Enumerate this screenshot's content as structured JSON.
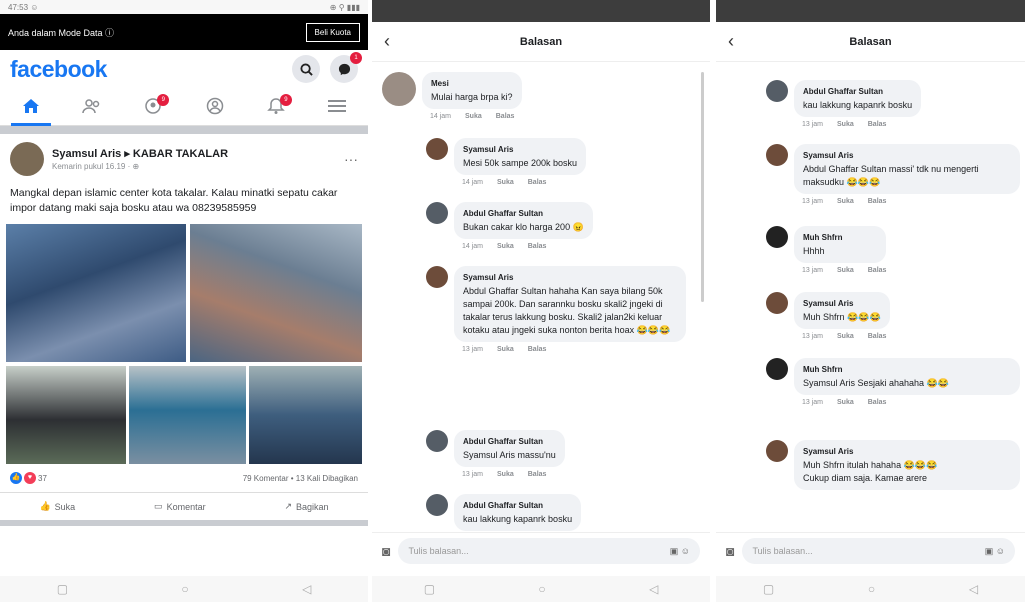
{
  "screen1": {
    "status_left": "47:53 ☺",
    "status_right": "⊕ ⚲ ▮▮▮",
    "data_mode": {
      "text": "Anda dalam Mode Data ⓘ",
      "button": "Beli Kuota"
    },
    "logo": "facebook",
    "search_icon": "search-icon",
    "messenger_badge": "1",
    "nav": [
      {
        "icon": "⌂",
        "name": "home"
      },
      {
        "icon": "👥",
        "name": "friends"
      },
      {
        "icon": "⚇",
        "name": "groups",
        "badge": "9"
      },
      {
        "icon": "◎",
        "name": "profile"
      },
      {
        "icon": "🔔",
        "name": "notifications",
        "badge": "9"
      },
      {
        "icon": "≡",
        "name": "menu"
      }
    ],
    "post": {
      "author": "Syamsul Aris ▸ KABAR TAKALAR",
      "meta": "Kemarin pukul 16.19 · ⊕",
      "text": "Mangkal depan islamic center kota takalar. Kalau minatki sepatu cakar impor datang maki saja bosku atau wa 08239585959",
      "reaction_count": "37",
      "stats": "79 Komentar • 13 Kali Dibagikan",
      "actions": {
        "like": "Suka",
        "comment": "Komentar",
        "share": "Bagikan"
      }
    }
  },
  "screen2": {
    "title": "Balasan",
    "input_placeholder": "Tulis balasan...",
    "comments": [
      {
        "name": "Mesi",
        "text": "Mulai harga brpa ki?",
        "time": "14 jam",
        "like": "Suka",
        "reply": "Balas"
      },
      {
        "name": "Syamsul Aris",
        "text": "Mesi 50k sampe 200k bosku",
        "time": "14 jam",
        "like": "Suka",
        "reply": "Balas"
      },
      {
        "name": "Abdul Ghaffar Sultan",
        "text": "Bukan cakar klo harga 200",
        "emoji": "😠",
        "time": "14 jam",
        "like": "Suka",
        "reply": "Balas"
      },
      {
        "name": "Syamsul Aris",
        "text": "Abdul Ghaffar Sultan hahaha Kan saya bilang 50k sampai 200k. Dan sarannku bosku skali2 jngeki di takalar terus lakkung bosku. Skali2 jalan2ki keluar kotaku atau jngeki suka nonton berita hoax",
        "emoji": "😂😂😂",
        "time": "13 jam",
        "like": "Suka",
        "reply": "Balas"
      },
      {
        "name": "Abdul Ghaffar Sultan",
        "text": "Syamsul Aris massu'nu",
        "time": "13 jam",
        "like": "Suka",
        "reply": "Balas"
      },
      {
        "name": "Abdul Ghaffar Sultan",
        "text": "kau lakkung kapanrk bosku",
        "time": "",
        "like": "",
        "reply": ""
      }
    ]
  },
  "screen3": {
    "title": "Balasan",
    "input_placeholder": "Tulis balasan...",
    "comments": [
      {
        "name": "Abdul Ghaffar Sultan",
        "text": "kau lakkung kapanrk bosku",
        "time": "13 jam",
        "like": "Suka",
        "reply": "Balas"
      },
      {
        "name": "Syamsul Aris",
        "text": "Abdul Ghaffar Sultan massi' tdk nu mengerti maksudku",
        "emoji": "😂😂😂",
        "time": "13 jam",
        "like": "Suka",
        "reply": "Balas"
      },
      {
        "name": "Muh Shfrn",
        "text": "Hhhh",
        "time": "13 jam",
        "like": "Suka",
        "reply": "Balas"
      },
      {
        "name": "Syamsul Aris",
        "text": "Muh Shfrn",
        "emoji": "😂😂😂",
        "time": "13 jam",
        "like": "Suka",
        "reply": "Balas"
      },
      {
        "name": "Muh Shfrn",
        "text": "Syamsul Aris Sesjaki ahahaha",
        "emoji": "😂😂",
        "time": "13 jam",
        "like": "Suka",
        "reply": "Balas"
      },
      {
        "name": "Syamsul Aris",
        "text": "Muh Shfrn itulah hahaha",
        "emoji": "😂😂😂",
        "text2": "Cukup diam saja. Kamae arere",
        "time": "",
        "like": "",
        "reply": ""
      }
    ]
  },
  "colors": {
    "fb_blue": "#1877f2",
    "bubble": "#f0f2f5",
    "red_badge": "#e41e3f"
  }
}
